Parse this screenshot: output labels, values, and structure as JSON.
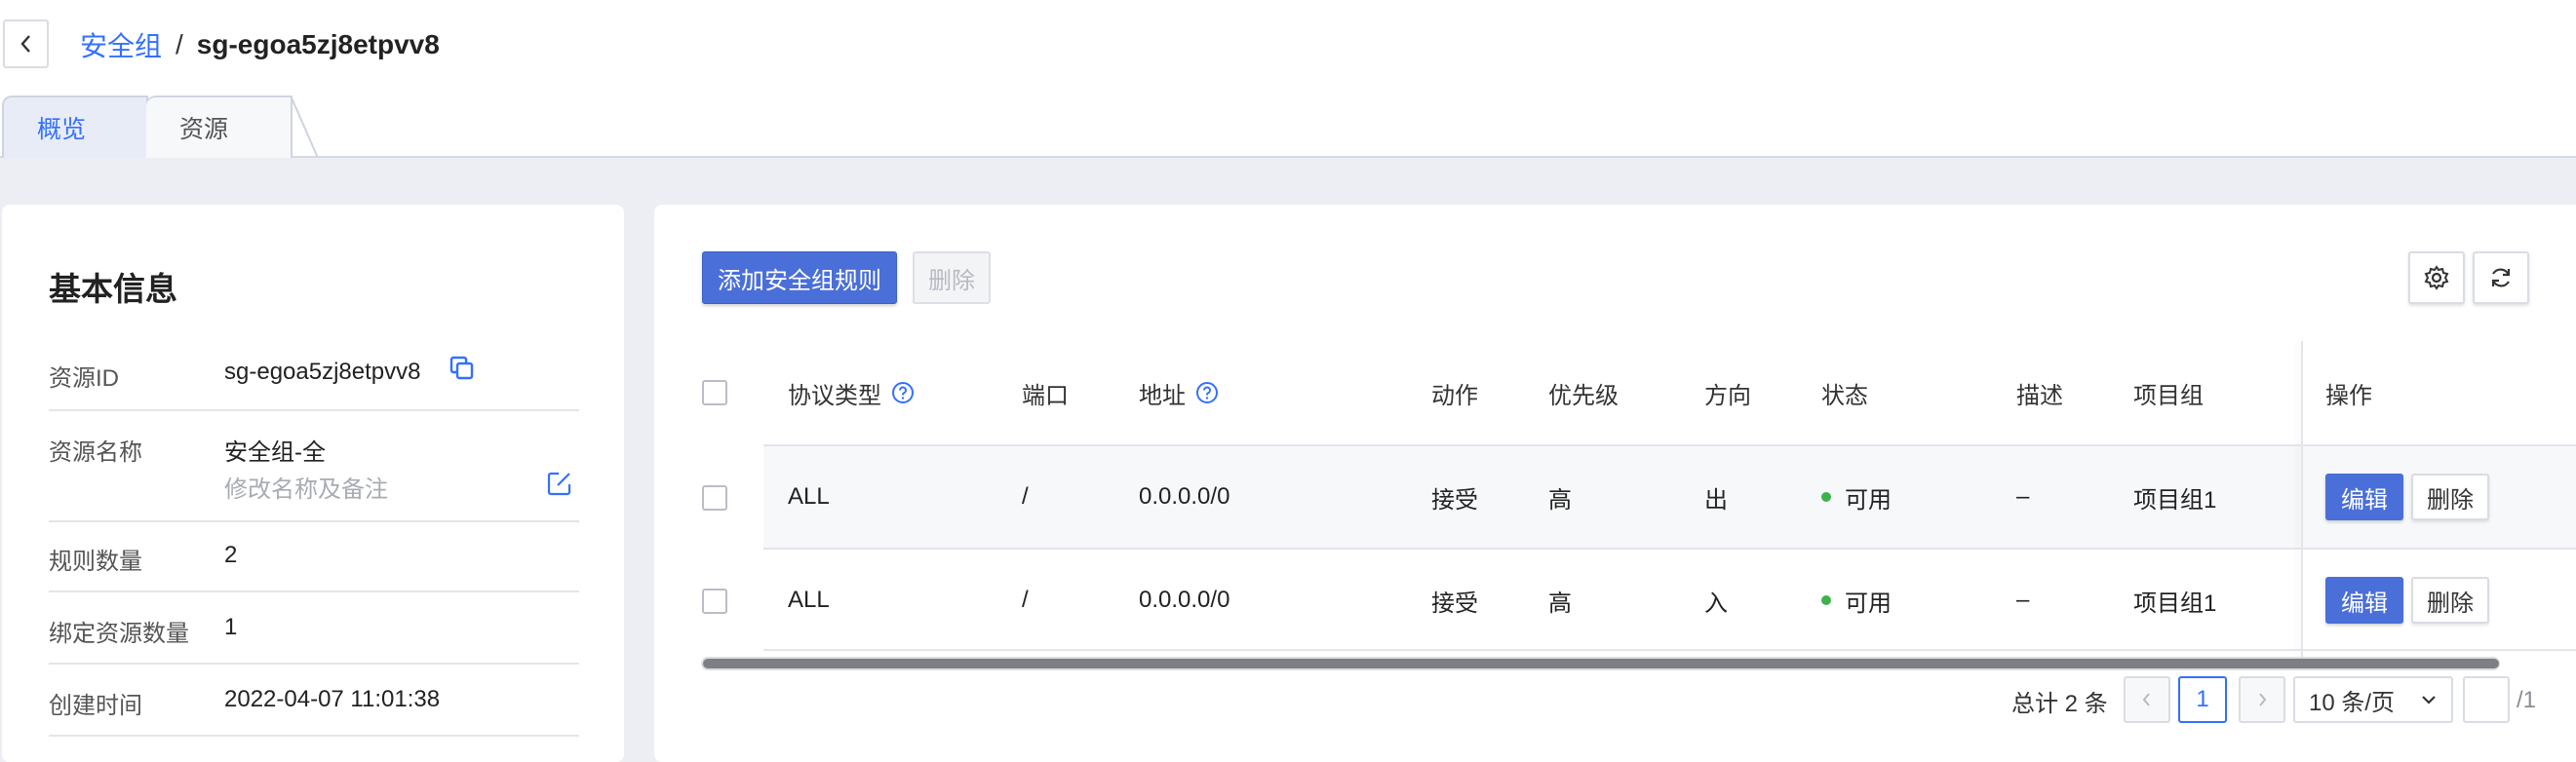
{
  "breadcrumb": {
    "parent": "安全组",
    "separator": "/",
    "current": "sg-egoa5zj8etpvv8"
  },
  "tabs": [
    {
      "label": "概览"
    },
    {
      "label": "资源"
    }
  ],
  "basic_info": {
    "title": "基本信息",
    "resource_id_label": "资源ID",
    "resource_id_value": "sg-egoa5zj8etpvv8",
    "resource_name_label": "资源名称",
    "resource_name_value": "安全组-全",
    "resource_name_hint": "修改名称及备注",
    "rule_count_label": "规则数量",
    "rule_count_value": "2",
    "bound_count_label": "绑定资源数量",
    "bound_count_value": "1",
    "created_label": "创建时间",
    "created_value": "2022-04-07 11:01:38"
  },
  "toolbar": {
    "add_label": "添加安全组规则",
    "delete_label": "删除"
  },
  "table": {
    "headers": {
      "protocol": "协议类型",
      "port": "端口",
      "address": "地址",
      "action": "动作",
      "priority": "优先级",
      "direction": "方向",
      "status": "状态",
      "description": "描述",
      "project": "项目组",
      "operation": "操作"
    },
    "rows": [
      {
        "protocol": "ALL",
        "port": "/",
        "address": "0.0.0.0/0",
        "action": "接受",
        "priority": "高",
        "direction": "出",
        "status": "可用",
        "description": "–",
        "project": "项目组1",
        "edit": "编辑",
        "delete": "删除"
      },
      {
        "protocol": "ALL",
        "port": "/",
        "address": "0.0.0.0/0",
        "action": "接受",
        "priority": "高",
        "direction": "入",
        "status": "可用",
        "description": "–",
        "project": "项目组1",
        "edit": "编辑",
        "delete": "删除"
      }
    ]
  },
  "pagination": {
    "total_text": "总计 2 条",
    "current_page": "1",
    "page_size": "10 条/页",
    "page_total": "/1"
  },
  "colors": {
    "accent": "#3370ff",
    "primary_button": "#4a6fd8",
    "status_ok": "#3bb34a"
  }
}
